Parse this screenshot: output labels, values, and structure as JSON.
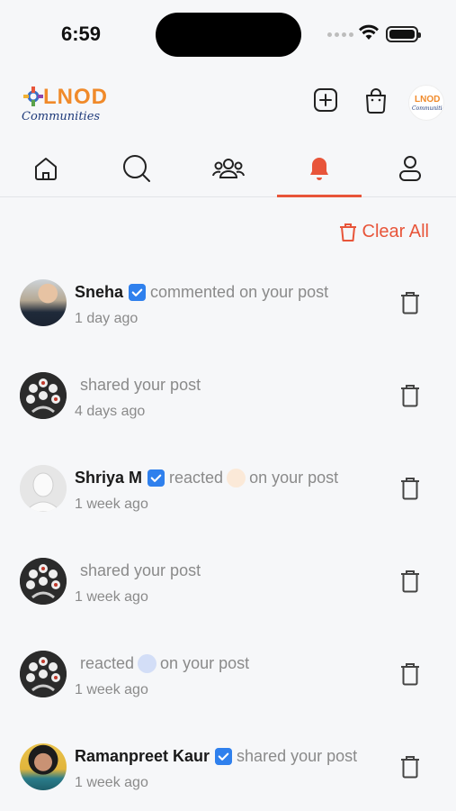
{
  "status_bar": {
    "time": "6:59"
  },
  "brand": {
    "logo_word": "LNOD",
    "logo_sub": "Communities"
  },
  "colors": {
    "accent": "#e8553a",
    "verified": "#2f80ed",
    "text_muted": "#8a8a8a"
  },
  "header": {
    "icons": [
      "plus-square-icon",
      "shopping-bag-icon"
    ]
  },
  "tabs": [
    {
      "icon": "home-icon",
      "active": false
    },
    {
      "icon": "search-icon",
      "active": false
    },
    {
      "icon": "group-icon",
      "active": false
    },
    {
      "icon": "bell-icon",
      "active": true
    },
    {
      "icon": "profile-icon",
      "active": false
    }
  ],
  "clear_all_label": "Clear All",
  "notifications": [
    {
      "name": "Sneha",
      "verified": true,
      "action": "commented on your post",
      "time": "1 day ago"
    },
    {
      "name": "",
      "verified": false,
      "action": "shared your post",
      "time": "4 days ago"
    },
    {
      "name": "Shriya M",
      "verified": true,
      "action_pre": "reacted",
      "reaction_color": "#fbe9d8",
      "action_post": "on your post",
      "time": "1 week ago"
    },
    {
      "name": "",
      "verified": false,
      "action": "shared your post",
      "time": "1 week ago"
    },
    {
      "name": "",
      "verified": false,
      "action_pre": "reacted",
      "reaction_color": "#d3def7",
      "action_post": "on your post",
      "time": "1 week ago"
    },
    {
      "name": "Ramanpreet Kaur",
      "verified": true,
      "action": "shared your post",
      "time": "1 week ago"
    }
  ]
}
